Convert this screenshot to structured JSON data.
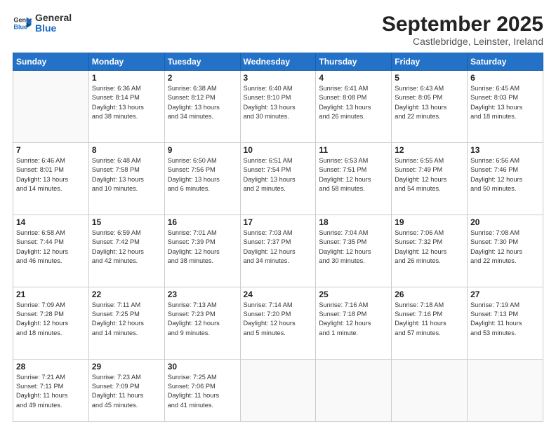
{
  "header": {
    "logo_line1": "General",
    "logo_line2": "Blue",
    "month": "September 2025",
    "location": "Castlebridge, Leinster, Ireland"
  },
  "days_of_week": [
    "Sunday",
    "Monday",
    "Tuesday",
    "Wednesday",
    "Thursday",
    "Friday",
    "Saturday"
  ],
  "weeks": [
    [
      {
        "day": "",
        "text": ""
      },
      {
        "day": "1",
        "text": "Sunrise: 6:36 AM\nSunset: 8:14 PM\nDaylight: 13 hours\nand 38 minutes."
      },
      {
        "day": "2",
        "text": "Sunrise: 6:38 AM\nSunset: 8:12 PM\nDaylight: 13 hours\nand 34 minutes."
      },
      {
        "day": "3",
        "text": "Sunrise: 6:40 AM\nSunset: 8:10 PM\nDaylight: 13 hours\nand 30 minutes."
      },
      {
        "day": "4",
        "text": "Sunrise: 6:41 AM\nSunset: 8:08 PM\nDaylight: 13 hours\nand 26 minutes."
      },
      {
        "day": "5",
        "text": "Sunrise: 6:43 AM\nSunset: 8:05 PM\nDaylight: 13 hours\nand 22 minutes."
      },
      {
        "day": "6",
        "text": "Sunrise: 6:45 AM\nSunset: 8:03 PM\nDaylight: 13 hours\nand 18 minutes."
      }
    ],
    [
      {
        "day": "7",
        "text": "Sunrise: 6:46 AM\nSunset: 8:01 PM\nDaylight: 13 hours\nand 14 minutes."
      },
      {
        "day": "8",
        "text": "Sunrise: 6:48 AM\nSunset: 7:58 PM\nDaylight: 13 hours\nand 10 minutes."
      },
      {
        "day": "9",
        "text": "Sunrise: 6:50 AM\nSunset: 7:56 PM\nDaylight: 13 hours\nand 6 minutes."
      },
      {
        "day": "10",
        "text": "Sunrise: 6:51 AM\nSunset: 7:54 PM\nDaylight: 13 hours\nand 2 minutes."
      },
      {
        "day": "11",
        "text": "Sunrise: 6:53 AM\nSunset: 7:51 PM\nDaylight: 12 hours\nand 58 minutes."
      },
      {
        "day": "12",
        "text": "Sunrise: 6:55 AM\nSunset: 7:49 PM\nDaylight: 12 hours\nand 54 minutes."
      },
      {
        "day": "13",
        "text": "Sunrise: 6:56 AM\nSunset: 7:46 PM\nDaylight: 12 hours\nand 50 minutes."
      }
    ],
    [
      {
        "day": "14",
        "text": "Sunrise: 6:58 AM\nSunset: 7:44 PM\nDaylight: 12 hours\nand 46 minutes."
      },
      {
        "day": "15",
        "text": "Sunrise: 6:59 AM\nSunset: 7:42 PM\nDaylight: 12 hours\nand 42 minutes."
      },
      {
        "day": "16",
        "text": "Sunrise: 7:01 AM\nSunset: 7:39 PM\nDaylight: 12 hours\nand 38 minutes."
      },
      {
        "day": "17",
        "text": "Sunrise: 7:03 AM\nSunset: 7:37 PM\nDaylight: 12 hours\nand 34 minutes."
      },
      {
        "day": "18",
        "text": "Sunrise: 7:04 AM\nSunset: 7:35 PM\nDaylight: 12 hours\nand 30 minutes."
      },
      {
        "day": "19",
        "text": "Sunrise: 7:06 AM\nSunset: 7:32 PM\nDaylight: 12 hours\nand 26 minutes."
      },
      {
        "day": "20",
        "text": "Sunrise: 7:08 AM\nSunset: 7:30 PM\nDaylight: 12 hours\nand 22 minutes."
      }
    ],
    [
      {
        "day": "21",
        "text": "Sunrise: 7:09 AM\nSunset: 7:28 PM\nDaylight: 12 hours\nand 18 minutes."
      },
      {
        "day": "22",
        "text": "Sunrise: 7:11 AM\nSunset: 7:25 PM\nDaylight: 12 hours\nand 14 minutes."
      },
      {
        "day": "23",
        "text": "Sunrise: 7:13 AM\nSunset: 7:23 PM\nDaylight: 12 hours\nand 9 minutes."
      },
      {
        "day": "24",
        "text": "Sunrise: 7:14 AM\nSunset: 7:20 PM\nDaylight: 12 hours\nand 5 minutes."
      },
      {
        "day": "25",
        "text": "Sunrise: 7:16 AM\nSunset: 7:18 PM\nDaylight: 12 hours\nand 1 minute."
      },
      {
        "day": "26",
        "text": "Sunrise: 7:18 AM\nSunset: 7:16 PM\nDaylight: 11 hours\nand 57 minutes."
      },
      {
        "day": "27",
        "text": "Sunrise: 7:19 AM\nSunset: 7:13 PM\nDaylight: 11 hours\nand 53 minutes."
      }
    ],
    [
      {
        "day": "28",
        "text": "Sunrise: 7:21 AM\nSunset: 7:11 PM\nDaylight: 11 hours\nand 49 minutes."
      },
      {
        "day": "29",
        "text": "Sunrise: 7:23 AM\nSunset: 7:09 PM\nDaylight: 11 hours\nand 45 minutes."
      },
      {
        "day": "30",
        "text": "Sunrise: 7:25 AM\nSunset: 7:06 PM\nDaylight: 11 hours\nand 41 minutes."
      },
      {
        "day": "",
        "text": ""
      },
      {
        "day": "",
        "text": ""
      },
      {
        "day": "",
        "text": ""
      },
      {
        "day": "",
        "text": ""
      }
    ]
  ]
}
